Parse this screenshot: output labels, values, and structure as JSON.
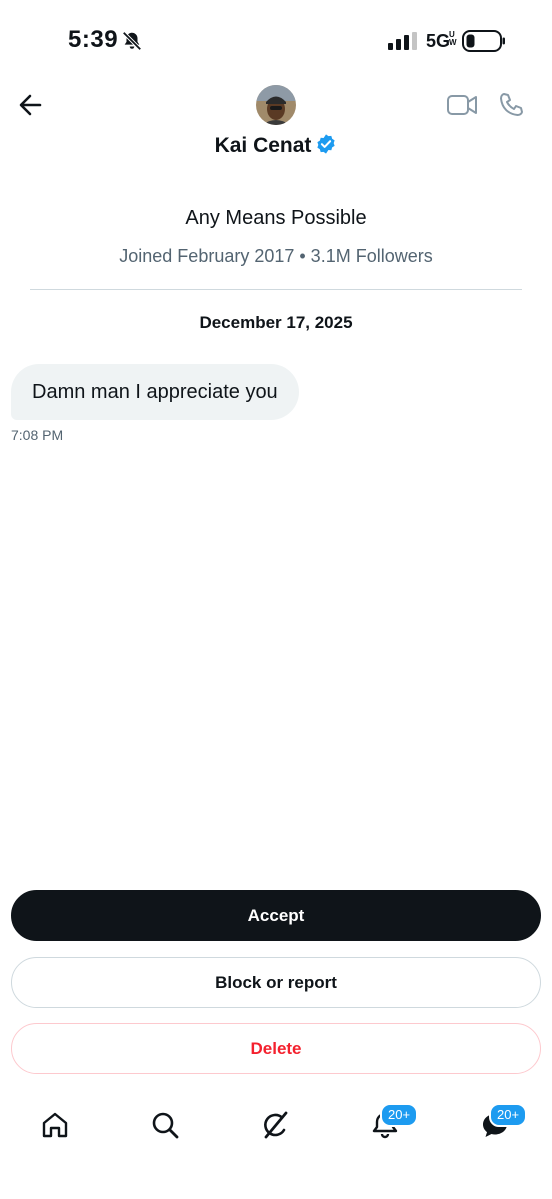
{
  "status_bar": {
    "time": "5:39",
    "network": "5G",
    "network_sup": "UW"
  },
  "header": {
    "name": "Kai Cenat"
  },
  "profile": {
    "bio": "Any Means Possible",
    "meta": "Joined February 2017 • 3.1M Followers"
  },
  "conversation": {
    "date": "December 17, 2025",
    "messages": [
      {
        "text": "Damn man I appreciate you",
        "time": "7:08 PM"
      }
    ]
  },
  "actions": {
    "accept": "Accept",
    "block_report": "Block or report",
    "delete": "Delete"
  },
  "bottom_nav": {
    "notifications_badge": "20+",
    "messages_badge": "20+"
  },
  "colors": {
    "accent": "#1d9bf0",
    "danger": "#f4212e",
    "text_primary": "#0f1419",
    "text_secondary": "#536471"
  }
}
